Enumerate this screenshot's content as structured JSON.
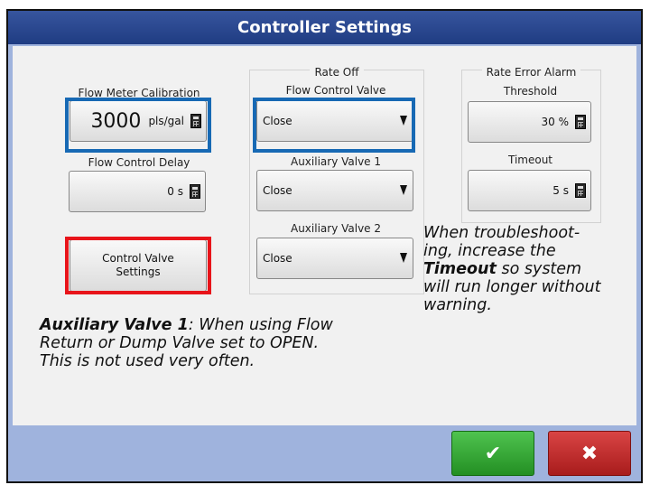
{
  "window": {
    "title": "Controller Settings"
  },
  "flow_meter": {
    "label": "Flow Meter Calibration",
    "value": "3000",
    "unit": "pls/gal"
  },
  "flow_control_delay": {
    "label": "Flow Control Delay",
    "value": "0 s"
  },
  "control_valve_button": {
    "line1": "Control Valve",
    "line2": "Settings"
  },
  "rate_off": {
    "title": "Rate Off",
    "flow_control_valve": {
      "label": "Flow Control Valve",
      "value": "Close"
    },
    "auxiliary_valve_1": {
      "label": "Auxiliary Valve 1",
      "value": "Close"
    },
    "auxiliary_valve_2": {
      "label": "Auxiliary Valve 2",
      "value": "Close"
    }
  },
  "rate_error_alarm": {
    "title": "Rate Error Alarm",
    "threshold": {
      "label": "Threshold",
      "value": "30 %"
    },
    "timeout": {
      "label": "Timeout",
      "value": "5 s"
    }
  },
  "notes": {
    "right": {
      "line1": "When troubleshoot-",
      "line2": "ing, increase the",
      "line3_bold": "Timeout",
      "line3_rest": " so system",
      "line4": "will run longer without",
      "line5": "warning."
    },
    "bottom": {
      "bold": "Auxiliary Valve 1",
      "line1_rest": ": When using Flow",
      "line2": "Return or Dump Valve set to OPEN.",
      "line3": "This is not used very often."
    }
  },
  "buttons": {
    "ok_icon": "checkmark-icon",
    "cancel_icon": "x-icon",
    "ok_glyph": "✔",
    "cancel_glyph": "✖"
  },
  "colors": {
    "title_bar": "#264389",
    "highlight_blue": "#1769b4",
    "highlight_red": "#e8141a",
    "ok_green": "#2fa52f",
    "cancel_red": "#c42b2b"
  }
}
